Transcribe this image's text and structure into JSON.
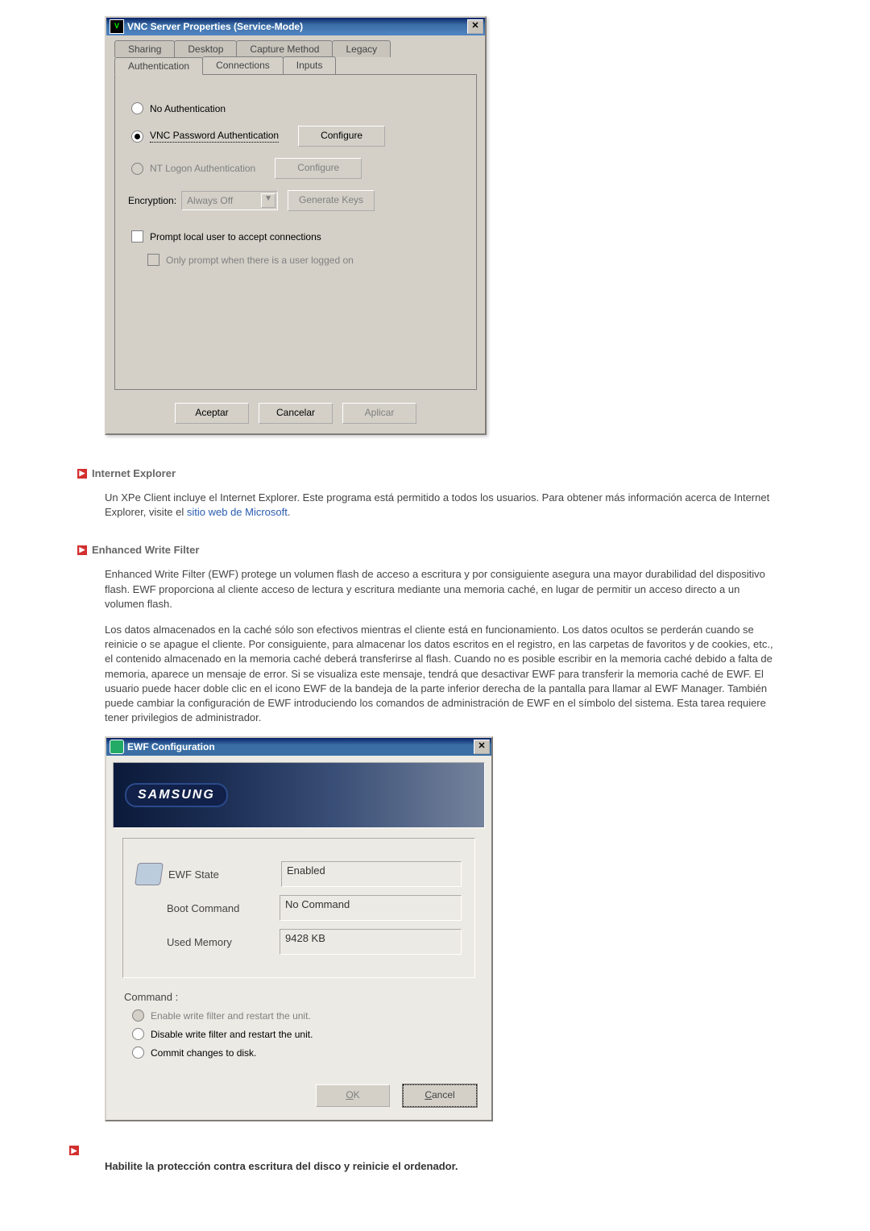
{
  "vnc": {
    "title": "VNC Server Properties (Service-Mode)",
    "tabs_back": [
      "Sharing",
      "Desktop",
      "Capture Method",
      "Legacy"
    ],
    "tabs_front": {
      "auth": "Authentication",
      "conn": "Connections",
      "inputs": "Inputs"
    },
    "opt_no_auth": "No Authentication",
    "opt_vnc_pw": "VNC Password Authentication",
    "opt_nt": "NT Logon Authentication",
    "btn_configure": "Configure",
    "lbl_encryption": "Encryption:",
    "sel_encryption": "Always Off",
    "btn_genkeys": "Generate Keys",
    "chk_prompt": "Prompt local user to accept connections",
    "chk_only_prompt": "Only prompt when there is a user logged on",
    "btn_ok": "Aceptar",
    "btn_cancel": "Cancelar",
    "btn_apply": "Aplicar"
  },
  "sec_ie": {
    "title": "Internet Explorer",
    "p1": "Un XPe Client incluye el Internet Explorer. Este programa está permitido a todos los usuarios. Para obtener más información acerca de Internet Explorer, visite el ",
    "link": "sitio web de Microsoft",
    "end": "."
  },
  "sec_ewf": {
    "title": "Enhanced Write Filter",
    "p1": "Enhanced Write Filter (EWF) protege un volumen flash de acceso a escritura y por consiguiente asegura una mayor durabilidad del dispositivo flash. EWF proporciona al cliente acceso de lectura y escritura mediante una memoria caché, en lugar de permitir un acceso directo a un volumen flash.",
    "p2": "Los datos almacenados en la caché sólo son efectivos mientras el cliente está en funcionamiento. Los datos ocultos se perderán cuando se reinicie o se apague el cliente. Por consiguiente, para almacenar los datos escritos en el registro, en las carpetas de favoritos y de cookies, etc., el contenido almacenado en la memoria caché deberá transferirse al flash. Cuando no es posible escribir en la memoria caché debido a falta de memoria, aparece un mensaje de error. Si se visualiza este mensaje, tendrá que desactivar EWF para transferir la memoria caché de EWF. El usuario puede hacer doble clic en el icono EWF de la bandeja de la parte inferior derecha de la pantalla para llamar al EWF Manager. También puede cambiar la configuración de EWF introduciendo los comandos de administración de EWF en el símbolo del sistema. Esta tarea requiere tener privilegios de administrador."
  },
  "ewf": {
    "title": "EWF Configuration",
    "brand": "SAMSUNG",
    "lbl_state": "EWF State",
    "lbl_boot": "Boot Command",
    "lbl_mem": "Used Memory",
    "val_state": "Enabled",
    "val_boot": "No Command",
    "val_mem": "9428 KB",
    "cmd_head": "Command :",
    "opt_enable": "Enable write filter and restart the unit.",
    "opt_disable": "Disable write filter and restart the unit.",
    "opt_commit": "Commit changes to disk.",
    "btn_ok_u": "O",
    "btn_ok_rest": "K",
    "btn_cancel_u": "C",
    "btn_cancel_rest": "ancel"
  },
  "last": "Habilite la protección contra escritura del disco y reinicie el ordenador."
}
